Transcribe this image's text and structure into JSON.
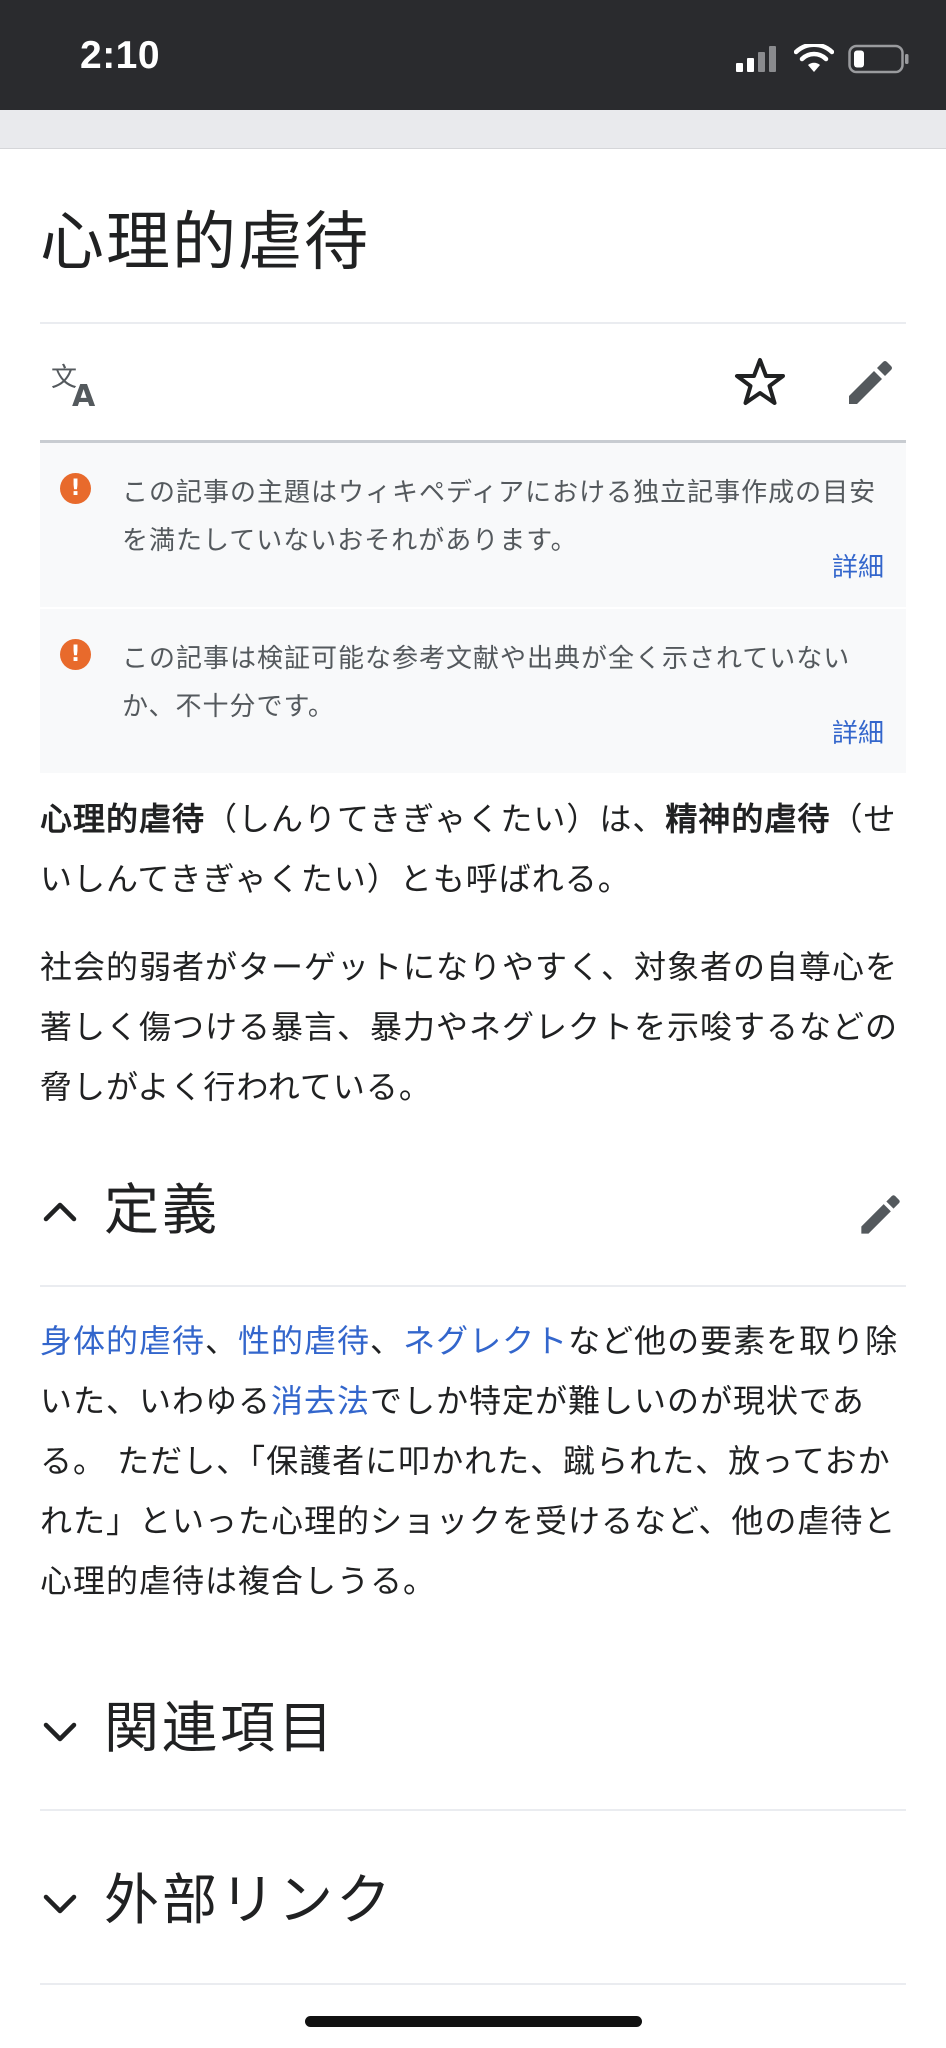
{
  "status_bar": {
    "time": "2:10"
  },
  "article": {
    "title": "心理的虐待",
    "actions": {
      "language_icon": "translate-icon",
      "watch_icon": "star-icon",
      "edit_icon": "pencil-icon"
    },
    "notices": [
      {
        "text": "この記事の主題はウィキペディアにおける独立記事作成の目安を満たしていないおそれがあります。",
        "more": "詳細"
      },
      {
        "text": "この記事は検証可能な参考文献や出典が全く示されていないか、不十分です。",
        "more": "詳細"
      }
    ],
    "lead": {
      "term1": "心理的虐待",
      "reading1": "（しんりてきぎゃくたい）は、",
      "term2": "精神的虐待",
      "reading2": "（せいしんてきぎゃくたい）とも呼ばれる。"
    },
    "paragraph2": "社会的弱者がターゲットになりやすく、対象者の自尊心を著しく傷つける暴言、暴力やネグレクトを示唆するなどの脅しがよく行われている。",
    "sections": [
      {
        "title": "定義",
        "expanded": true,
        "body": {
          "link1": "身体的虐待",
          "sep1": "、",
          "link2": "性的虐待",
          "sep2": "、",
          "link3": "ネグレクト",
          "text1": "など他の要素を取り除いた、いわゆる",
          "link4": "消去法",
          "text2": "でしか特定が難しいのが現状である。 ただし、「保護者に叩かれた、蹴られた、放っておかれた」といった心理的ショックを受けるなど、他の虐待と心理的虐待は複合しうる。"
        }
      },
      {
        "title": "関連項目",
        "expanded": false
      },
      {
        "title": "外部リンク",
        "expanded": false
      }
    ]
  },
  "colors": {
    "link": "#3366cc",
    "warning": "#e86a2c",
    "status_bar": "#2a2b2e"
  }
}
